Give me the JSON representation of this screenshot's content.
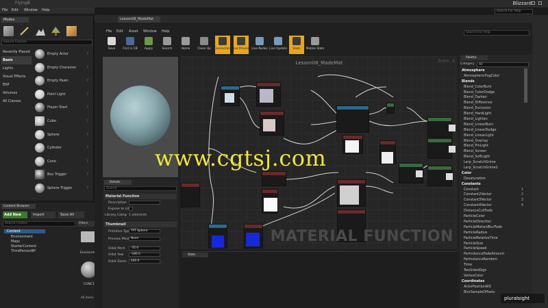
{
  "window": {
    "title": "FlyingB",
    "brand": "Blizzard",
    "menu": [
      "File",
      "Edit",
      "Window",
      "Help"
    ],
    "search_placeholder": "Search For Help"
  },
  "modes": {
    "tab": "Modes",
    "search_placeholder": "Search Classes",
    "categories": [
      "Recently Placed",
      "Basic",
      "Lights",
      "Visual Effects",
      "BSP",
      "Volumes",
      "All Classes"
    ],
    "selected_category": "Basic",
    "assets": [
      "Empty Actor",
      "Empty Character",
      "Empty Pawn",
      "Point Light",
      "Player Start",
      "Cube",
      "Sphere",
      "Cylinder",
      "Cone",
      "Box Trigger",
      "Sphere Trigger"
    ],
    "help_glyph": "?"
  },
  "content_browser": {
    "tab": "Content Browser",
    "add_new": "Add New",
    "import": "Import",
    "save_all": "Save All",
    "search_placeholder": "Search Folders",
    "filters": "Filters",
    "tree": [
      "Content",
      "Environment",
      "Maps",
      "StarterContent",
      "ThirdPersonBP"
    ],
    "asset_label": "CONC1",
    "folder_label": "Environment",
    "item_count": "46 items (1 selected)"
  },
  "material_editor": {
    "tab": "Lesson08_MadeMat",
    "menu": [
      "File",
      "Edit",
      "Asset",
      "Window",
      "Help"
    ],
    "search_placeholder": "Search For Help",
    "toolbar": [
      {
        "label": "Save",
        "on": false
      },
      {
        "label": "Find in CB",
        "on": false
      },
      {
        "label": "Apply",
        "on": false
      },
      {
        "label": "Search",
        "on": false
      },
      {
        "label": "Home",
        "on": false
      },
      {
        "label": "Clean Up",
        "on": false
      },
      {
        "label": "Connectors",
        "on": true
      },
      {
        "label": "Live Preview",
        "on": true
      },
      {
        "label": "Live Nodes",
        "on": false
      },
      {
        "label": "Live Update",
        "on": false
      },
      {
        "label": "Stats",
        "on": true
      },
      {
        "label": "Mobile Stats",
        "on": false
      }
    ],
    "graph_title": "Lesson08_MadeMat",
    "zoom": "Zoom -4",
    "material_function": "MATERIAL FUNCTION",
    "stats_tab": "Stats",
    "watermark": "www.cgtsj.com"
  },
  "details": {
    "tab": "Details",
    "search_placeholder": "Search",
    "section_mf": "Material Function",
    "description_label": "Description",
    "expose_label": "Expose to Lib",
    "library_label": "Library Categ",
    "library_value": "1 elements",
    "section_thumb": "Thumbnail",
    "primitive_label": "Primitive Typ",
    "primitive_value": "TPT Sphere",
    "preview_label": "Preview Mesl",
    "preview_value": "None",
    "pitch_label": "Orbit Pitch",
    "pitch_value": "-35.0",
    "yaw_label": "Orbit Yaw",
    "yaw_value": "-180.0",
    "zoom_label": "Orbit Zoom",
    "zoom_value": "400.0"
  },
  "palette": {
    "tab": "Palette",
    "category_label": "Category",
    "category_value": "All",
    "items": [
      {
        "t": "Atmosphere",
        "h": true
      },
      {
        "t": "AtmosphericFogColor"
      },
      {
        "t": "Blends",
        "h": true
      },
      {
        "t": "Blend_ColorBurn"
      },
      {
        "t": "Blend_ColorDodge"
      },
      {
        "t": "Blend_Darken"
      },
      {
        "t": "Blend_Difference"
      },
      {
        "t": "Blend_Exclusion"
      },
      {
        "t": "Blend_HardLight"
      },
      {
        "t": "Blend_Lighten"
      },
      {
        "t": "Blend_LinearBurn"
      },
      {
        "t": "Blend_LinearDodge"
      },
      {
        "t": "Blend_LinearLight"
      },
      {
        "t": "Blend_Overlay"
      },
      {
        "t": "Blend_PinLight"
      },
      {
        "t": "Blend_Screen"
      },
      {
        "t": "Blend_SoftLight"
      },
      {
        "t": "Lerp_ScratchGrime"
      },
      {
        "t": "Lerp_ScratchGrime2"
      },
      {
        "t": "Color",
        "h": true
      },
      {
        "t": "Desaturation"
      },
      {
        "t": "Constants",
        "h": true
      },
      {
        "t": "Constant",
        "k": "1"
      },
      {
        "t": "Constant2Vector",
        "k": "2"
      },
      {
        "t": "Constant3Vector",
        "k": "3"
      },
      {
        "t": "Constant4Vector",
        "k": "4"
      },
      {
        "t": "DistanceCullFade"
      },
      {
        "t": "ParticleColor"
      },
      {
        "t": "ParticleDirection"
      },
      {
        "t": "ParticleMotionBlurFade"
      },
      {
        "t": "ParticleRadius"
      },
      {
        "t": "ParticleRelativeTime"
      },
      {
        "t": "ParticleSize"
      },
      {
        "t": "ParticleSpeed"
      },
      {
        "t": "PerInstanceFadeAmount"
      },
      {
        "t": "PerInstanceRandom"
      },
      {
        "t": "Time"
      },
      {
        "t": "TwoSidedSign"
      },
      {
        "t": "VertexColor"
      },
      {
        "t": "Coordinates",
        "h": true
      },
      {
        "t": "ActorPositionWS"
      },
      {
        "t": "BlurSampleOffsets"
      }
    ]
  },
  "pluralsight": "pluralsight"
}
